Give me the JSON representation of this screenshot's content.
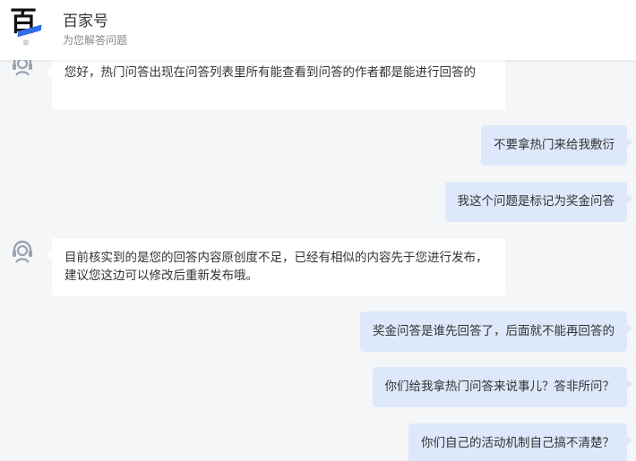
{
  "header": {
    "title": "百家号",
    "subtitle": "为您解答问题",
    "logo_icon": "baijiahao-logo-icon"
  },
  "messages": [
    {
      "side": "left",
      "text": "您好，热门问答出现在问答列表里所有能查看到问答的作者都是能进行回答的"
    },
    {
      "side": "right",
      "text": "不要拿热门来给我敷衍"
    },
    {
      "side": "right",
      "text": "我这个问题是标记为奖金问答"
    },
    {
      "side": "left",
      "text": "目前核实到的是您的回答内容原创度不足，已经有相似的内容先于您进行发布，建议您这边可以修改后重新发布哦。"
    },
    {
      "side": "right",
      "text": "奖金问答是谁先回答了，后面就不能再回答的"
    },
    {
      "side": "right",
      "text": "你们给我拿热门问答来说事儿？答非所问？"
    },
    {
      "side": "right",
      "text": "你们自己的活动机制自己搞不清楚？"
    }
  ],
  "colors": {
    "page_background": "#f5f6f8",
    "left_bubble": "#ffffff",
    "right_bubble": "#dde8fa",
    "logo_accent": "#2f6ee8",
    "avatar_stroke": "#9aa3b0"
  }
}
